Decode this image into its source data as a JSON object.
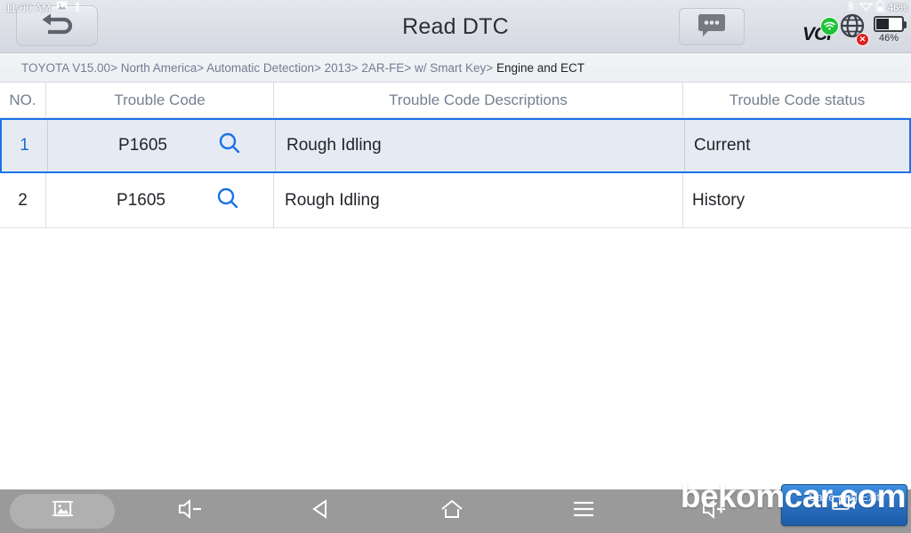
{
  "status_bar": {
    "time": "11:00 AM",
    "icons": [
      "image-icon",
      "upload-icon",
      "bluetooth-icon",
      "wifi-icon"
    ],
    "battery_percent": "46%"
  },
  "header": {
    "title": "Read DTC",
    "back_button_icon": "back-arrow-icon",
    "chat_button_icon": "chat-bubble-icon",
    "vci_label": "VCI",
    "vci_status_icon": "wifi-connected-icon",
    "network_icon": "globe-icon",
    "network_error_mark": "✕",
    "battery_percent": "46%",
    "battery_level": 46,
    "accent_color": "#1a73e8",
    "vci_badge_color": "#1dc437",
    "network_error_color": "#e02020"
  },
  "breadcrumb": {
    "segments": [
      "TOYOTA V15.00",
      "North America",
      "Automatic Detection",
      "2013",
      "2AR-FE",
      "w/ Smart Key",
      "Engine and ECT"
    ],
    "separator": ">",
    "full_text": "TOYOTA V15.00> North America> Automatic Detection> 2013> 2AR-FE> w/ Smart Key> Engine and ECT"
  },
  "table": {
    "columns": [
      "NO.",
      "Trouble Code",
      "Trouble Code Descriptions",
      "Trouble Code status"
    ],
    "rows": [
      {
        "no": "1",
        "code": "P1605",
        "search_icon": "search-icon",
        "description": "Rough Idling",
        "status": "Current",
        "selected": true
      },
      {
        "no": "2",
        "code": "P1605",
        "search_icon": "search-icon",
        "description": "Rough Idling",
        "status": "History",
        "selected": false
      }
    ]
  },
  "navbar": {
    "items": [
      {
        "name": "screenshot-icon",
        "label": ""
      },
      {
        "name": "volume-down-icon",
        "label": ""
      },
      {
        "name": "back-triangle-icon",
        "label": ""
      },
      {
        "name": "home-icon",
        "label": ""
      },
      {
        "name": "menu-icon",
        "label": ""
      },
      {
        "name": "volume-up-icon",
        "label": ""
      },
      {
        "name": "car-icon",
        "label": ""
      }
    ],
    "action_button": {
      "label": "Save and Exit",
      "icon": "video-record-icon"
    }
  },
  "watermark": {
    "text": "bekomcar.com"
  }
}
